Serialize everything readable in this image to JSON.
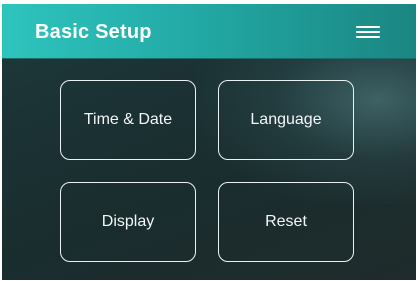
{
  "header": {
    "title": "Basic Setup",
    "menu_icon": "hamburger-menu-icon"
  },
  "tiles": [
    {
      "id": "time-date",
      "label": "Time & Date"
    },
    {
      "id": "language",
      "label": "Language"
    },
    {
      "id": "display",
      "label": "Display"
    },
    {
      "id": "reset",
      "label": "Reset"
    }
  ],
  "colors": {
    "header_start": "#2ec4bd",
    "header_end": "#1a8682",
    "background": "#1b3133",
    "tile_border": "#e9f2f2",
    "text": "#ffffff"
  }
}
